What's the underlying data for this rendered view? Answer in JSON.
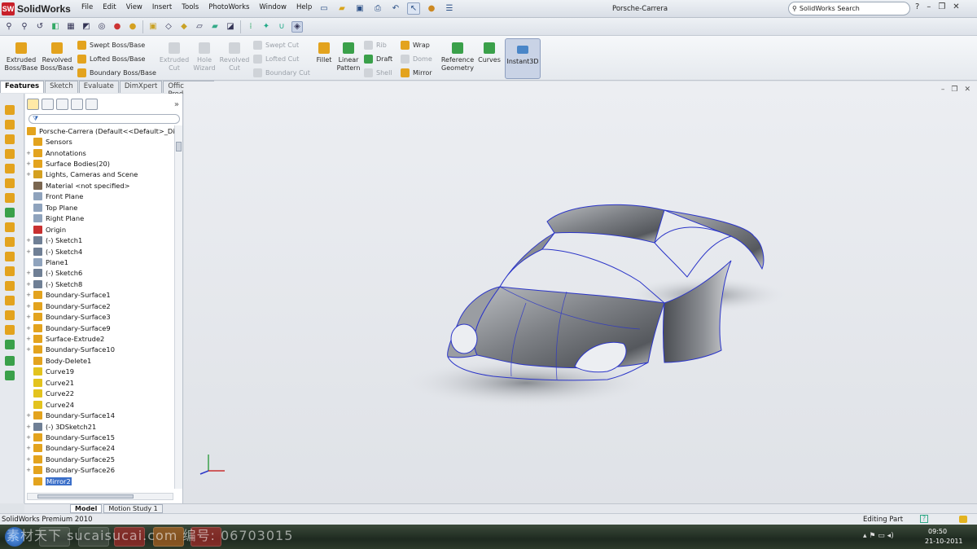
{
  "app": {
    "name": "SolidWorks",
    "document_title": "Porsche-Carrera"
  },
  "menu": [
    "File",
    "Edit",
    "View",
    "Insert",
    "Tools",
    "PhotoWorks",
    "Window",
    "Help"
  ],
  "search": {
    "placeholder": "SolidWorks Search"
  },
  "command_manager": {
    "extruded_boss": "Extruded Boss/Base",
    "revolved_boss": "Revolved Boss/Base",
    "swept_boss": "Swept Boss/Base",
    "lofted_boss": "Lofted Boss/Base",
    "boundary_boss": "Boundary Boss/Base",
    "extruded_cut": "Extruded Cut",
    "hole_wizard": "Hole Wizard",
    "revolved_cut": "Revolved Cut",
    "swept_cut": "Swept Cut",
    "lofted_cut": "Lofted Cut",
    "boundary_cut": "Boundary Cut",
    "fillet": "Fillet",
    "linear_pattern": "Linear Pattern",
    "rib": "Rib",
    "draft": "Draft",
    "shell": "Shell",
    "wrap": "Wrap",
    "dome": "Dome",
    "mirror": "Mirror",
    "reference_geometry": "Reference Geometry",
    "curves": "Curves",
    "instant3d": "Instant3D"
  },
  "tabs": [
    "Features",
    "Sketch",
    "Evaluate",
    "DimXpert",
    "Office Products"
  ],
  "tree": {
    "root": "Porsche-Carrera  (Default<<Default>_Dis",
    "items": [
      "Sensors",
      "Annotations",
      "Surface Bodies(20)",
      "Lights, Cameras and Scene",
      "Material <not specified>",
      "Front Plane",
      "Top Plane",
      "Right Plane",
      "Origin",
      "(-) Sketch1",
      "(-) Sketch4",
      "Plane1",
      "(-) Sketch6",
      "(-) Sketch8",
      "Boundary-Surface1",
      "Boundary-Surface2",
      "Boundary-Surface3",
      "Boundary-Surface9",
      "Surface-Extrude2",
      "Boundary-Surface10",
      "Body-Delete1",
      "Curve19",
      "Curve21",
      "Curve22",
      "Curve24",
      "Boundary-Surface14",
      "(-) 3DSketch21",
      "Boundary-Surface15",
      "Boundary-Surface24",
      "Boundary-Surface25",
      "Boundary-Surface26",
      "Mirror2"
    ]
  },
  "bottom_tabs": [
    "Model",
    "Motion Study 1"
  ],
  "status": {
    "left": "SolidWorks Premium 2010",
    "right": "Editing Part"
  },
  "clock": {
    "time": "09:50",
    "date": "21-10-2011"
  },
  "watermark": "素材天下 sucaisucai.com  编号: 06703015",
  "colors": {
    "accent": "#3b6fc9",
    "feature_icon": "#e8a020",
    "curve": "#2b35c8"
  }
}
